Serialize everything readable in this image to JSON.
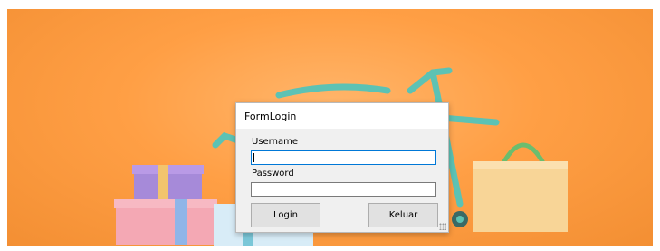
{
  "window": {
    "title": "FormLogin"
  },
  "form": {
    "username_label": "Username",
    "username_value": "",
    "password_label": "Password",
    "password_value": "",
    "login_label": "Login",
    "exit_label": "Keluar"
  },
  "colors": {
    "background": "#ff9f45",
    "focus_border": "#0078d7",
    "button_face": "#e1e1e1"
  }
}
